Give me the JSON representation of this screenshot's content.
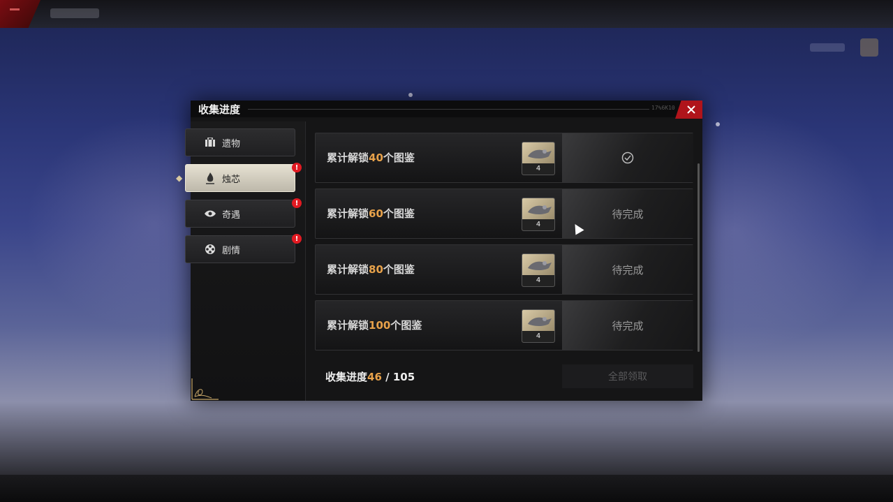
{
  "dialog": {
    "title": "收集进度",
    "code": "17%6K10",
    "close_icon": "close-icon"
  },
  "sidebar": {
    "items": [
      {
        "label": "遗物",
        "icon": "suitcase-icon",
        "active": false,
        "badge": false
      },
      {
        "label": "烛芯",
        "icon": "flame-icon",
        "active": true,
        "badge": true
      },
      {
        "label": "奇遇",
        "icon": "eye-icon",
        "active": false,
        "badge": true
      },
      {
        "label": "剧情",
        "icon": "film-reel-icon",
        "active": false,
        "badge": true
      }
    ],
    "badge_symbol": "!"
  },
  "tasks": [
    {
      "prefix": "累计解锁",
      "num": "40",
      "suffix": "个图鉴",
      "reward_count": "4",
      "status": "",
      "completed": true
    },
    {
      "prefix": "累计解锁",
      "num": "60",
      "suffix": "个图鉴",
      "reward_count": "4",
      "status": "待完成",
      "completed": false
    },
    {
      "prefix": "累计解锁",
      "num": "80",
      "suffix": "个图鉴",
      "reward_count": "4",
      "status": "待完成",
      "completed": false
    },
    {
      "prefix": "累计解锁",
      "num": "100",
      "suffix": "个图鉴",
      "reward_count": "4",
      "status": "待完成",
      "completed": false
    }
  ],
  "progress": {
    "label": "收集进度",
    "current": "46",
    "separator": " / ",
    "total": "105"
  },
  "claim_all_label": "全部领取",
  "colors": {
    "accent": "#e8a24a",
    "close": "#b0141b",
    "badge": "#e21a22"
  }
}
